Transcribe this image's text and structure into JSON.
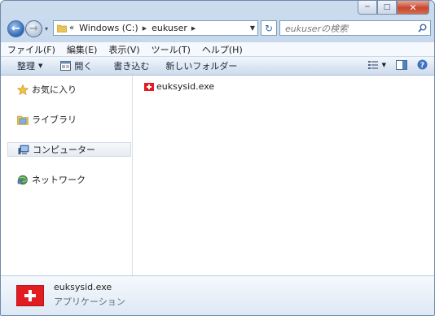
{
  "window": {
    "caption_buttons": {
      "minimize": "─",
      "maximize": "□",
      "close": "✕"
    }
  },
  "navigation": {
    "back_icon": "back-arrow-icon",
    "forward_icon": "forward-arrow-icon",
    "history_chevron": "▾",
    "address": {
      "overflow": "«",
      "crumbs": [
        "Windows (C:)",
        "eukuser"
      ],
      "separator": "▶"
    },
    "refresh_symbol": "↻",
    "search": {
      "placeholder": "eukuserの検索",
      "value": ""
    }
  },
  "menubar": {
    "items": [
      "ファイル(F)",
      "編集(E)",
      "表示(V)",
      "ツール(T)",
      "ヘルプ(H)"
    ]
  },
  "toolbar": {
    "organize_label": "整理",
    "open_label": "開く",
    "burn_label": "書き込む",
    "new_folder_label": "新しいフォルダー",
    "views_icon": "views-icon",
    "preview_pane_icon": "preview-pane-icon",
    "help_icon": "help-icon"
  },
  "sidebar": {
    "items": [
      {
        "label": "お気に入り",
        "icon": "star-icon"
      },
      {
        "label": "ライブラリ",
        "icon": "library-icon"
      },
      {
        "label": "コンピューター",
        "icon": "computer-icon",
        "selected": true
      },
      {
        "label": "ネットワーク",
        "icon": "network-icon"
      }
    ]
  },
  "files": [
    {
      "name": "euksysid.exe",
      "icon": "swiss-flag-icon"
    }
  ],
  "details": {
    "name": "euksysid.exe",
    "type": "アプリケーション"
  },
  "colors": {
    "accent_blue": "#2f67b7",
    "flag_red": "#e21d22",
    "close_red": "#c8462e",
    "chrome_blue": "#bed3ea"
  }
}
